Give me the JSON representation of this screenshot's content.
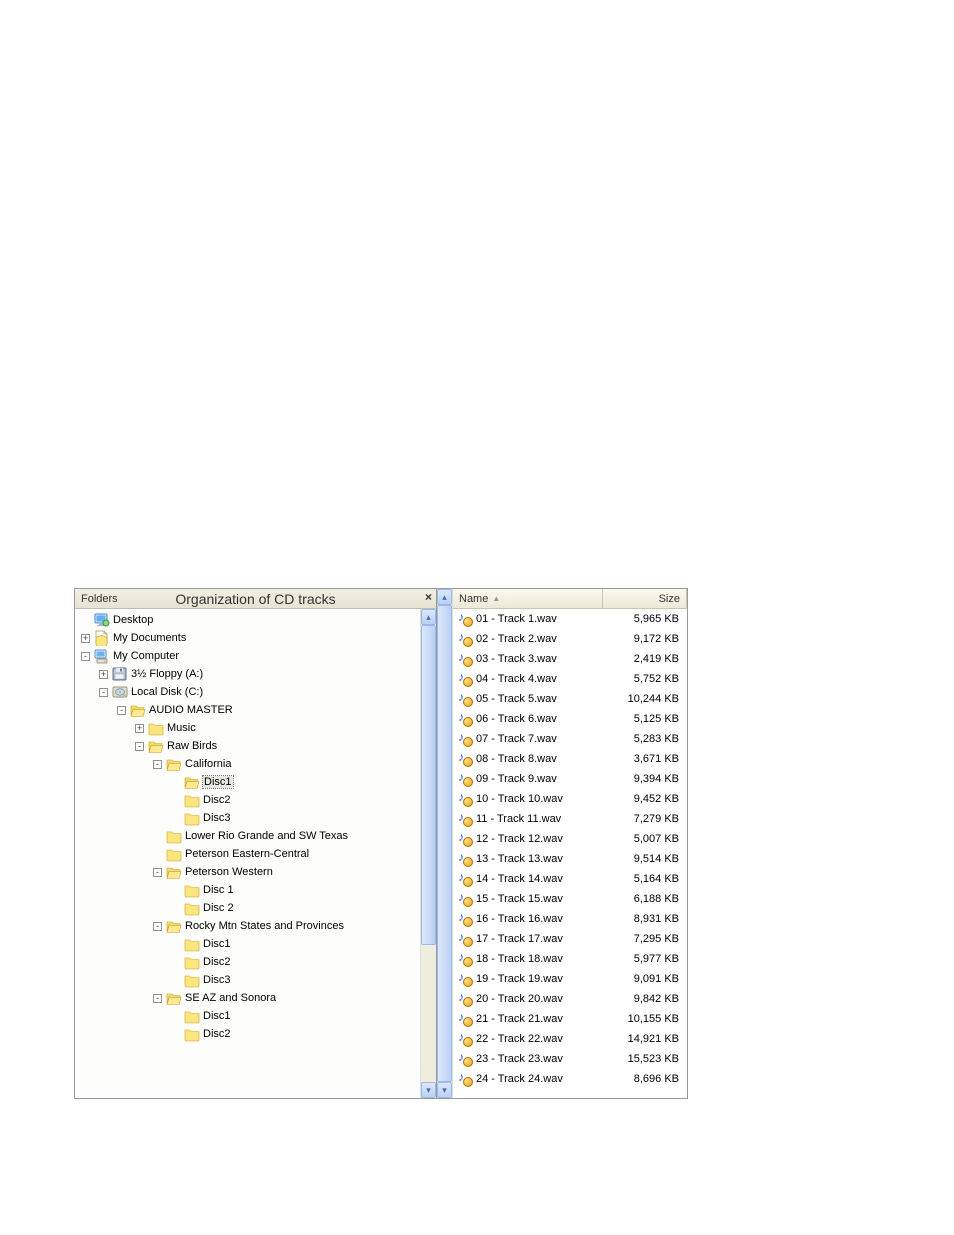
{
  "header": {
    "folders_label": "Folders",
    "title": "Organization of CD tracks",
    "close_label": "×"
  },
  "columns": {
    "name": "Name",
    "size": "Size",
    "sort_indicator": "▲"
  },
  "tree": [
    {
      "id": "desktop",
      "indent": 0,
      "toggle": "",
      "icon": "desktop",
      "label": "Desktop"
    },
    {
      "id": "my-documents",
      "indent": 0,
      "toggle": "+",
      "icon": "mydocs",
      "label": "My Documents"
    },
    {
      "id": "my-computer",
      "indent": 0,
      "toggle": "-",
      "icon": "computer",
      "label": "My Computer"
    },
    {
      "id": "floppy",
      "indent": 1,
      "toggle": "+",
      "icon": "floppy",
      "label": "3½ Floppy (A:)"
    },
    {
      "id": "local-disk",
      "indent": 1,
      "toggle": "-",
      "icon": "disk",
      "label": "Local Disk (C:)"
    },
    {
      "id": "audio-master",
      "indent": 2,
      "toggle": "-",
      "icon": "folder-open",
      "label": "AUDIO MASTER"
    },
    {
      "id": "music",
      "indent": 3,
      "toggle": "+",
      "icon": "folder",
      "label": "Music"
    },
    {
      "id": "raw-birds",
      "indent": 3,
      "toggle": "-",
      "icon": "folder-open",
      "label": "Raw Birds"
    },
    {
      "id": "california",
      "indent": 4,
      "toggle": "-",
      "icon": "folder-open",
      "label": "California"
    },
    {
      "id": "ca-disc1",
      "indent": 5,
      "toggle": "",
      "icon": "folder-open",
      "label": "Disc1",
      "selected": true
    },
    {
      "id": "ca-disc2",
      "indent": 5,
      "toggle": "",
      "icon": "folder",
      "label": "Disc2"
    },
    {
      "id": "ca-disc3",
      "indent": 5,
      "toggle": "",
      "icon": "folder",
      "label": "Disc3"
    },
    {
      "id": "lrg-sw-texas",
      "indent": 4,
      "toggle": "",
      "icon": "folder",
      "label": "Lower Rio Grande and SW Texas"
    },
    {
      "id": "peterson-ec",
      "indent": 4,
      "toggle": "",
      "icon": "folder",
      "label": "Peterson Eastern-Central"
    },
    {
      "id": "peterson-w",
      "indent": 4,
      "toggle": "-",
      "icon": "folder-open",
      "label": "Peterson Western"
    },
    {
      "id": "pw-disc1",
      "indent": 5,
      "toggle": "",
      "icon": "folder",
      "label": "Disc 1"
    },
    {
      "id": "pw-disc2",
      "indent": 5,
      "toggle": "",
      "icon": "folder",
      "label": "Disc 2"
    },
    {
      "id": "rocky-mtn",
      "indent": 4,
      "toggle": "-",
      "icon": "folder-open",
      "label": "Rocky Mtn States and Provinces"
    },
    {
      "id": "rm-disc1",
      "indent": 5,
      "toggle": "",
      "icon": "folder",
      "label": "Disc1"
    },
    {
      "id": "rm-disc2",
      "indent": 5,
      "toggle": "",
      "icon": "folder",
      "label": "Disc2"
    },
    {
      "id": "rm-disc3",
      "indent": 5,
      "toggle": "",
      "icon": "folder",
      "label": "Disc3"
    },
    {
      "id": "se-az-sonora",
      "indent": 4,
      "toggle": "-",
      "icon": "folder-open",
      "label": "SE AZ and Sonora"
    },
    {
      "id": "sa-disc1",
      "indent": 5,
      "toggle": "",
      "icon": "folder",
      "label": "Disc1"
    },
    {
      "id": "sa-disc2",
      "indent": 5,
      "toggle": "",
      "icon": "folder",
      "label": "Disc2"
    }
  ],
  "files": [
    {
      "name": "01 - Track 1.wav",
      "size": "5,965 KB"
    },
    {
      "name": "02 - Track 2.wav",
      "size": "9,172 KB"
    },
    {
      "name": "03 - Track 3.wav",
      "size": "2,419 KB"
    },
    {
      "name": "04 - Track 4.wav",
      "size": "5,752 KB"
    },
    {
      "name": "05 - Track 5.wav",
      "size": "10,244 KB"
    },
    {
      "name": "06 - Track 6.wav",
      "size": "5,125 KB"
    },
    {
      "name": "07 - Track 7.wav",
      "size": "5,283 KB"
    },
    {
      "name": "08 - Track 8.wav",
      "size": "3,671 KB"
    },
    {
      "name": "09 - Track 9.wav",
      "size": "9,394 KB"
    },
    {
      "name": "10 - Track 10.wav",
      "size": "9,452 KB"
    },
    {
      "name": "11 - Track 11.wav",
      "size": "7,279 KB"
    },
    {
      "name": "12 - Track 12.wav",
      "size": "5,007 KB"
    },
    {
      "name": "13 - Track 13.wav",
      "size": "9,514 KB"
    },
    {
      "name": "14 - Track 14.wav",
      "size": "5,164 KB"
    },
    {
      "name": "15 - Track 15.wav",
      "size": "6,188 KB"
    },
    {
      "name": "16 - Track 16.wav",
      "size": "8,931 KB"
    },
    {
      "name": "17 - Track 17.wav",
      "size": "7,295 KB"
    },
    {
      "name": "18 - Track 18.wav",
      "size": "5,977 KB"
    },
    {
      "name": "19 - Track 19.wav",
      "size": "9,091 KB"
    },
    {
      "name": "20 - Track 20.wav",
      "size": "9,842 KB"
    },
    {
      "name": "21 - Track 21.wav",
      "size": "10,155 KB"
    },
    {
      "name": "22 - Track 22.wav",
      "size": "14,921 KB"
    },
    {
      "name": "23 - Track 23.wav",
      "size": "15,523 KB"
    },
    {
      "name": "24 - Track 24.wav",
      "size": "8,696 KB"
    }
  ]
}
